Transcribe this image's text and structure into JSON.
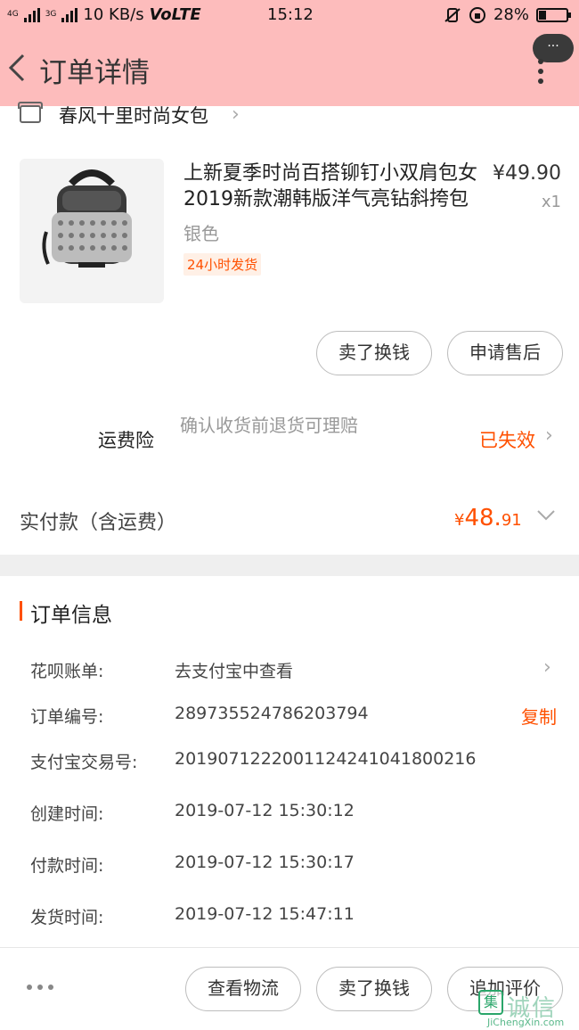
{
  "status_bar": {
    "net_left": "4G",
    "net_right": "3G",
    "speed": "10 KB/s",
    "volte": "VoLTE",
    "time": "15:12",
    "battery": "28%",
    "battery_fraction": 0.28
  },
  "header": {
    "title": "订单详情",
    "bubble": "···"
  },
  "shop": {
    "name": "春风十里时尚女包"
  },
  "product": {
    "title": "上新夏季时尚百搭铆钉小双肩包女2019新款潮韩版洋气亮钻斜挎包",
    "price": "¥49.90",
    "qty": "x1",
    "sku": "银色",
    "ship_tag": "24小时发货"
  },
  "item_actions": {
    "sell_label": "卖了换钱",
    "aftersale_label": "申请售后"
  },
  "insurance": {
    "label": "运费险",
    "desc": "确认收货前退货可理赔",
    "status": "已失效"
  },
  "payment": {
    "label": "实付款（含运费）",
    "symbol": "¥",
    "int": "48.",
    "dec": "91"
  },
  "order_info": {
    "title": "订单信息",
    "rows": [
      {
        "label": "花呗账单:",
        "value": "去支付宝中查看"
      },
      {
        "label": "订单编号:",
        "value": "289735524786203794"
      },
      {
        "label": "支付宝交易号:",
        "value": "2019071222001124241041800216"
      },
      {
        "label": "创建时间:",
        "value": "2019-07-12 15:30:12"
      },
      {
        "label": "付款时间:",
        "value": "2019-07-12 15:30:17"
      },
      {
        "label": "发货时间:",
        "value": "2019-07-12 15:47:11"
      }
    ],
    "copy_label": "复制"
  },
  "bottom_bar": {
    "logistics_label": "查看物流",
    "sell_label": "卖了换钱",
    "review_label": "追加评价"
  },
  "watermark": {
    "logo": "集",
    "text": "诚信",
    "url": "JiChengXin.com"
  },
  "colors": {
    "accent": "#ff5000",
    "header_bg": "#fdbcbc"
  }
}
